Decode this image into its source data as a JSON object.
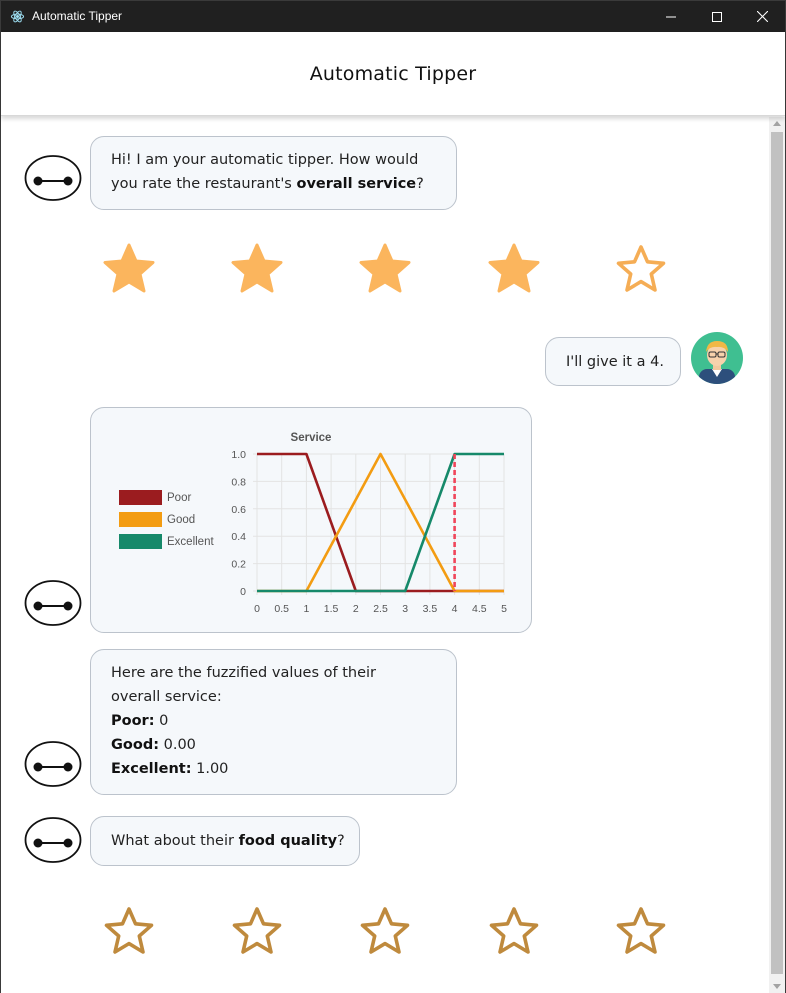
{
  "window": {
    "title": "Automatic Tipper"
  },
  "header": {
    "title": "Automatic Tipper"
  },
  "messages": {
    "service_question": {
      "prefix": "Hi! I am your automatic tipper. How would you rate the restaurant's ",
      "line1": "Hi! I am your automatic tipper. How would",
      "line2_prefix": "you rate the restaurant's ",
      "emphasis": "overall service",
      "suffix": "?"
    },
    "user_reply": "I'll give it a 4.",
    "fuzzified": {
      "line1": "Here are the fuzzified values of their",
      "line2": "overall service:",
      "poor_label": "Poor:",
      "poor_value": "0",
      "good_label": "Good:",
      "good_value": "0.00",
      "excellent_label": "Excellent:",
      "excellent_value": "1.00"
    },
    "food_question": {
      "prefix": "What about their ",
      "emphasis": "food quality",
      "suffix": "?"
    }
  },
  "service_rating": {
    "value": 4,
    "max": 5
  },
  "food_rating": {
    "value": 0,
    "max": 5
  },
  "colors": {
    "star_filled": "#fbb55d",
    "star_outline_service": "#f5ad55",
    "star_outline_food": "#bf8a3d",
    "poor": "#9b1c1f",
    "good": "#f39c12",
    "excellent": "#16896a",
    "marker": "#f0455a"
  },
  "chart_data": {
    "type": "line",
    "title": "Service",
    "xlim": [
      0,
      5
    ],
    "ylim": [
      0,
      1
    ],
    "x_ticks": [
      "0",
      "0.5",
      "1",
      "1.5",
      "2",
      "2.5",
      "3",
      "3.5",
      "4",
      "4.5",
      "5"
    ],
    "y_ticks": [
      "0",
      "0.2",
      "0.4",
      "0.6",
      "0.8",
      "1.0"
    ],
    "grid": true,
    "legend": "left",
    "series": [
      {
        "name": "Poor",
        "x": [
          0,
          1,
          2,
          5
        ],
        "y": [
          1,
          1,
          0,
          0
        ]
      },
      {
        "name": "Good",
        "x": [
          0,
          1,
          2.5,
          4,
          5
        ],
        "y": [
          0,
          0,
          1,
          0,
          0
        ]
      },
      {
        "name": "Excellent",
        "x": [
          0,
          3,
          4,
          5
        ],
        "y": [
          0,
          0,
          1,
          1
        ]
      }
    ],
    "marker": {
      "x": 4,
      "style": "dashed"
    }
  }
}
